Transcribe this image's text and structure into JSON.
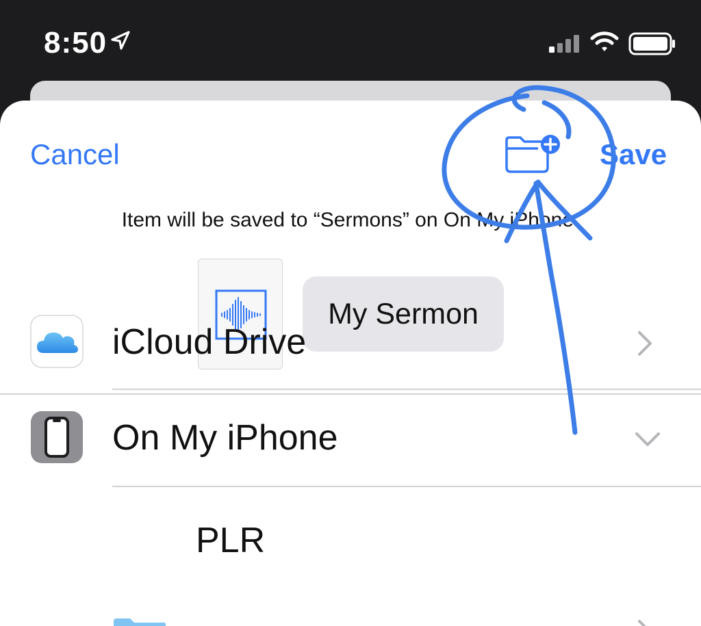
{
  "status_bar": {
    "time": "8:50",
    "icons": [
      "location-arrow-icon",
      "cellular-signal-icon",
      "wifi-icon",
      "battery-icon"
    ]
  },
  "header": {
    "cancel_label": "Cancel",
    "save_label": "Save",
    "new_folder_icon": "folder-plus-icon"
  },
  "save_info": "Item will be saved to “Sermons” on On My iPhone.",
  "file": {
    "icon": "audio-waveform-icon",
    "name": "My Sermon"
  },
  "locations": [
    {
      "label": "iCloud Drive",
      "icon": "icloud-icon",
      "chevron": "chevron-right-icon"
    },
    {
      "label": "On My iPhone",
      "icon": "iphone-icon",
      "chevron": "chevron-down-icon"
    },
    {
      "label": "PLR",
      "icon": "folder-icon",
      "chevron": "chevron-right-icon"
    }
  ],
  "colors": {
    "accent": "#3478f6",
    "annotation": "#3d7de8",
    "status_bar_bg": "#1c1c1e"
  }
}
